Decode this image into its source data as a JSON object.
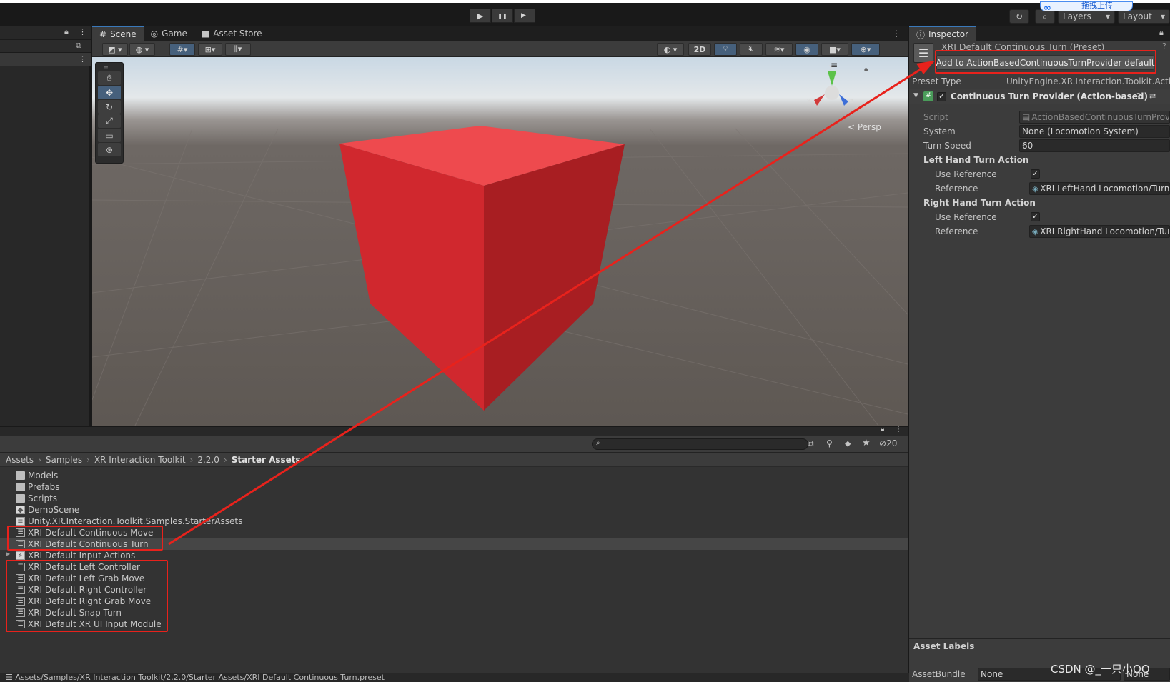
{
  "toolbar": {
    "play": "▶",
    "pause": "❚❚",
    "step": "▶|",
    "history_icon": "↻",
    "search_icon": "⌕",
    "layers": "Layers",
    "layout": "Layout",
    "upload_text": "拖拽上传"
  },
  "scene_panel": {
    "tabs": [
      "Scene",
      "Game",
      "Asset Store"
    ],
    "two_d": "2D",
    "persp": "< Persp",
    "gizmo_axes": {
      "y": "y",
      "x": "x",
      "z": "z"
    }
  },
  "inspector": {
    "tab": "Inspector",
    "title": "XRI Default Continuous Turn (Preset)",
    "add_button": "Add to ActionBasedContinuousTurnProvider default",
    "preset_type_label": "Preset Type",
    "preset_type_value": "UnityEngine.XR.Interaction.Toolkit.Actio",
    "component_name": "Continuous Turn Provider (Action-based)",
    "fields": {
      "script_label": "Script",
      "script_value": "ActionBasedContinuousTurnProvi",
      "system_label": "System",
      "system_value": "None (Locomotion System)",
      "turn_speed_label": "Turn Speed",
      "turn_speed_value": "60",
      "left_hand_header": "Left Hand Turn Action",
      "left_use_ref_label": "Use Reference",
      "left_ref_label": "Reference",
      "left_ref_value": "XRI LeftHand Locomotion/Turn",
      "right_hand_header": "Right Hand Turn Action",
      "right_use_ref_label": "Use Reference",
      "right_ref_label": "Reference",
      "right_ref_value": "XRI RightHand Locomotion/Turr"
    },
    "asset_labels": "Asset Labels",
    "asset_bundle_label": "AssetBundle",
    "asset_bundle_value": "None",
    "asset_bundle_variant": "None"
  },
  "project": {
    "hidden_count": "20",
    "breadcrumb": [
      "Assets",
      "Samples",
      "XR Interaction Toolkit",
      "2.2.0",
      "Starter Assets"
    ],
    "files": [
      {
        "name": "Models",
        "kind": "folder"
      },
      {
        "name": "Prefabs",
        "kind": "folder"
      },
      {
        "name": "Scripts",
        "kind": "folder"
      },
      {
        "name": "DemoScene",
        "kind": "scene"
      },
      {
        "name": "Unity.XR.Interaction.Toolkit.Samples.StarterAssets",
        "kind": "asmdef"
      },
      {
        "name": "XRI Default Continuous Move",
        "kind": "preset"
      },
      {
        "name": "XRI Default Continuous Turn",
        "kind": "preset"
      },
      {
        "name": "XRI Default Input Actions",
        "kind": "input"
      },
      {
        "name": "XRI Default Left Controller",
        "kind": "preset"
      },
      {
        "name": "XRI Default Left Grab Move",
        "kind": "preset"
      },
      {
        "name": "XRI Default Right Controller",
        "kind": "preset"
      },
      {
        "name": "XRI Default Right Grab Move",
        "kind": "preset"
      },
      {
        "name": "XRI Default Snap Turn",
        "kind": "preset"
      },
      {
        "name": "XRI Default XR UI Input Module",
        "kind": "preset"
      }
    ],
    "status_path": "Assets/Samples/XR Interaction Toolkit/2.2.0/Starter Assets/XRI Default Continuous Turn.preset"
  },
  "watermark": "CSDN @_一只小QQ",
  "colors": {
    "annotation_red": "#e8221c",
    "cube_red": "#d93a3e",
    "accent_blue": "#3a79bb"
  }
}
